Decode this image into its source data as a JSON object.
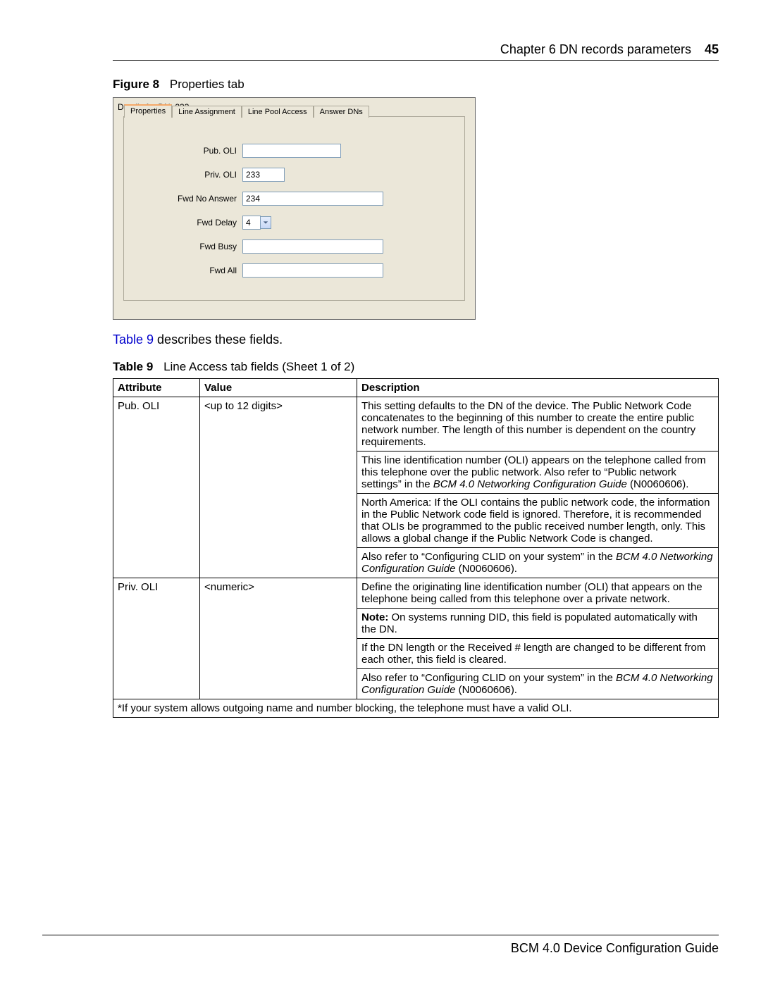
{
  "header": {
    "chapter": "Chapter 6  DN records parameters",
    "page_number": "45"
  },
  "figure": {
    "label": "Figure 8",
    "title": "Properties tab"
  },
  "screenshot": {
    "panel_title": "Details for DN: 233",
    "tabs": [
      "Properties",
      "Line Assignment",
      "Line Pool Access",
      "Answer DNs"
    ],
    "active_tab_index": 0,
    "fields": {
      "pub_oli": {
        "label": "Pub. OLI",
        "value": ""
      },
      "priv_oli": {
        "label": "Priv. OLI",
        "value": "233"
      },
      "fwd_no_answer": {
        "label": "Fwd No Answer",
        "value": "234"
      },
      "fwd_delay": {
        "label": "Fwd Delay",
        "value": "4"
      },
      "fwd_busy": {
        "label": "Fwd Busy",
        "value": ""
      },
      "fwd_all": {
        "label": "Fwd All",
        "value": ""
      }
    }
  },
  "bridge": {
    "link_text": "Table 9",
    "rest": " describes these fields."
  },
  "table_caption": {
    "label": "Table 9",
    "title": "Line Access tab fields (Sheet 1 of 2)"
  },
  "table": {
    "headers": [
      "Attribute",
      "Value",
      "Description"
    ],
    "rows": [
      {
        "attribute": "Pub. OLI",
        "value": "<up to 12 digits>",
        "desc": [
          "This setting defaults to the DN of the device. The Public Network Code concatenates to the beginning of this number to create the entire public network number. The length of this number is dependent on the country requirements.",
          {
            "pre": "This line identification number (OLI) appears on the telephone called from this telephone over the public network. Also refer to “Public network settings” in the ",
            "ital": "BCM 4.0 Networking Configuration Guide",
            "post": " (N0060606)."
          },
          "North America: If the OLI contains the public network code, the information in the Public Network code field is ignored. Therefore, it is recommended that OLIs be programmed to the public received number length, only. This allows a global change if the Public Network Code is changed.",
          {
            "pre": "Also refer to “Configuring CLID on your system” in the ",
            "ital": "BCM 4.0 Networking Configuration Guide",
            "post": " (N0060606)."
          }
        ]
      },
      {
        "attribute": "Priv. OLI",
        "value": "<numeric>",
        "desc": [
          "Define the originating line identification number (OLI) that appears on the telephone being called from this telephone over a private network.",
          {
            "bold": "Note:",
            "post": " On systems running DID, this field is populated automatically with the DN."
          },
          "If the DN length or the Received # length are changed to be different from each other, this field is cleared.",
          {
            "pre": "Also refer to “Configuring CLID on your system” in the ",
            "ital": "BCM 4.0 Networking Configuration Guide",
            "post": " (N0060606)."
          }
        ]
      }
    ],
    "footnote": "*If your system allows outgoing name and number blocking, the telephone must have a valid OLI."
  },
  "footer": "BCM 4.0 Device Configuration Guide"
}
